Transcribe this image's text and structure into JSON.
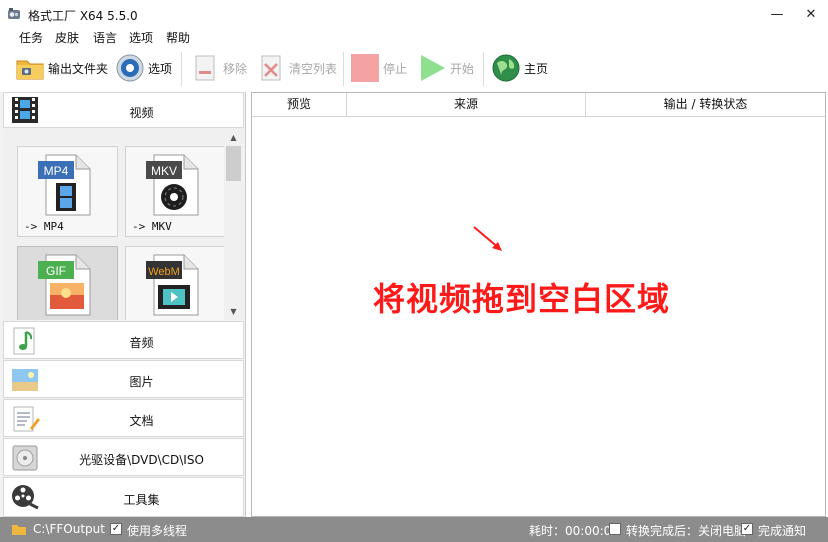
{
  "window": {
    "title": "格式工厂 X64 5.5.0",
    "minimize": "—",
    "maximize": "☐",
    "close": "✕"
  },
  "menu": [
    "任务",
    "皮肤",
    "语言",
    "选项",
    "帮助"
  ],
  "toolbar": {
    "output_folder": "输出文件夹",
    "options": "选项",
    "remove": "移除",
    "clear_list": "清空列表",
    "stop": "停止",
    "start": "开始",
    "home": "主页"
  },
  "categories": {
    "video": "视频",
    "audio": "音频",
    "picture": "图片",
    "document": "文档",
    "rom": "光驱设备\\DVD\\CD\\ISO",
    "tools": "工具集"
  },
  "tiles": [
    {
      "badge": "MP4",
      "label": "-> MP4"
    },
    {
      "badge": "MKV",
      "label": "-> MKV"
    },
    {
      "badge": "GIF",
      "label": ""
    },
    {
      "badge": "WebM",
      "label": ""
    }
  ],
  "columns": [
    "预览",
    "来源",
    "输出 / 转换状态"
  ],
  "hint": "将视频拖到空白区域",
  "status": {
    "path": "C:\\FFOutput",
    "multithread": "使用多线程",
    "elapsed": "耗时：00:00:00",
    "after_done": "转换完成后：关闭电脑",
    "notify": "完成通知"
  },
  "colors": {
    "hint": "#ff1a1a",
    "statusbar": "#8c8c8c",
    "mp4_badge": "#3b6fb6",
    "mkv_badge": "#4a4a4a",
    "gif_badge": "#4caf50",
    "webm_badge": "#333333"
  }
}
